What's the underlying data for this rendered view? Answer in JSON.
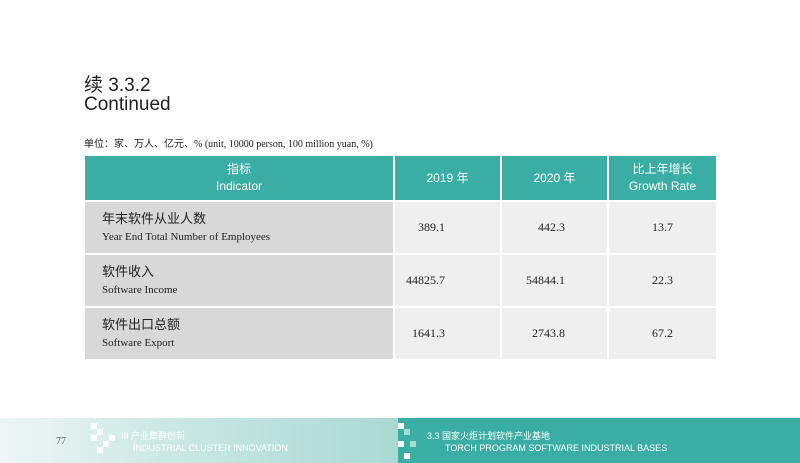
{
  "header": {
    "title_cn": "续 3.3.2",
    "title_en": "Continued",
    "unit_note": "单位：家、万人、亿元、% (unit, 10000 person, 100 million yuan, %)"
  },
  "table": {
    "columns": [
      {
        "cn": "指标",
        "en": "Indicator"
      },
      {
        "cn": "2019 年",
        "en": ""
      },
      {
        "cn": "2020 年",
        "en": ""
      },
      {
        "cn": "比上年增长",
        "en": "Growth Rate"
      }
    ],
    "rows": [
      {
        "cn": "年末软件从业人数",
        "en": "Year End Total Number of Employees",
        "v2019": "389.1",
        "v2020": "442.3",
        "growth": "13.7"
      },
      {
        "cn": "软件收入",
        "en": "Software Income",
        "v2019": "44825.7",
        "v2020": "54844.1",
        "growth": "22.3"
      },
      {
        "cn": "软件出口总额",
        "en": "Software Export",
        "v2019": "1641.3",
        "v2020": "2743.8",
        "growth": "67.2"
      }
    ]
  },
  "footer": {
    "page_number": "77",
    "left_section_cn": "III 产业集群创新",
    "left_section_en": "INDUSTRIAL CLUSTER INNOVATION",
    "right_section_cn": "3.3 国家火炬计划软件产业基地",
    "right_section_en": "TORCH PROGRAM SOFTWARE INDUSTRIAL BASES"
  },
  "colors": {
    "accent": "#3aaea3",
    "row_label_bg": "#d8d8d8",
    "row_value_bg": "#efefef"
  }
}
